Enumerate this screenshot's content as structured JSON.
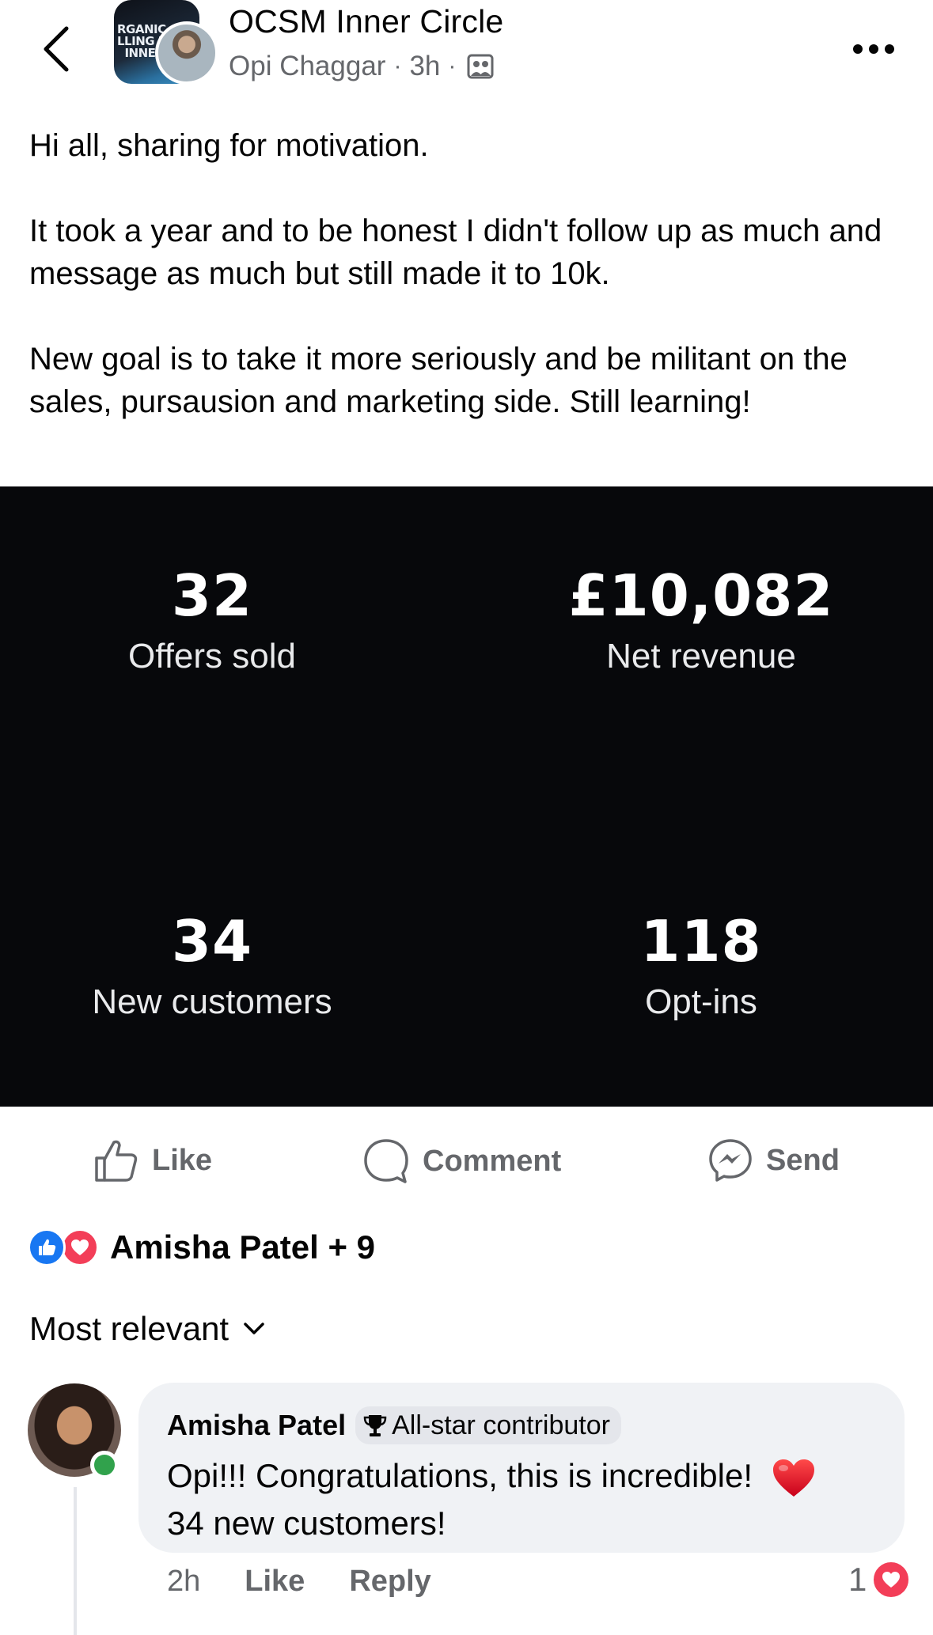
{
  "header": {
    "group_name": "OCSM Inner Circle",
    "author": "Opi Chaggar",
    "time": "3h",
    "separator": "·",
    "group_avatar_text": "RGANIC C\nLLING M\n  INNER C"
  },
  "post": {
    "paragraphs": [
      "Hi all, sharing for motivation.",
      "It took a year and to be honest I didn't follow up as much and message as much but still made it to 10k.",
      "New goal is to take it more seriously and be militant on the sales, pursausion and marketing side. Still learning!"
    ]
  },
  "stats": [
    {
      "value": "32",
      "label": "Offers sold"
    },
    {
      "value": "£10,082",
      "label": "Net revenue"
    },
    {
      "value": "34",
      "label": "New customers"
    },
    {
      "value": "118",
      "label": "Opt-ins"
    }
  ],
  "actions": {
    "like": "Like",
    "comment": "Comment",
    "send": "Send"
  },
  "reactions": {
    "summary": "Amisha Patel + 9",
    "icons": [
      "like-icon",
      "love-icon"
    ]
  },
  "comments_sort": {
    "label": "Most relevant"
  },
  "comment": {
    "author": "Amisha Patel",
    "badge": "All-star contributor",
    "text_line1": "Opi!!! Congratulations, this is incredible!",
    "text_line2": "34 new customers!",
    "time": "2h",
    "like": "Like",
    "reply": "Reply",
    "reaction_count": "1"
  },
  "colors": {
    "secondary_text": "#65676b",
    "like_blue": "#1877f2",
    "love_red": "#f33e58",
    "online_green": "#31a24c",
    "stats_bg": "#07080b"
  }
}
